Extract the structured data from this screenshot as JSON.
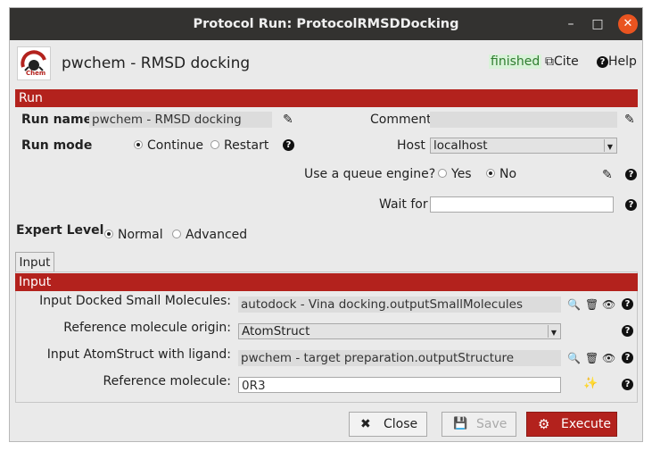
{
  "window": {
    "title": "Protocol Run: ProtocolRMSDDocking",
    "minimize": "–",
    "maximize": "□",
    "close": "✕"
  },
  "header": {
    "logo_text": "Chem",
    "title": "pwchem - RMSD docking",
    "status": "finished",
    "cite": "Cite",
    "help": "Help",
    "cite_icon": "external-link-icon",
    "help_icon": "question-circle-icon"
  },
  "run_section": {
    "title": "Run",
    "run_name_label": "Run name",
    "run_name_value": "pwchem - RMSD docking",
    "comment_label": "Comment",
    "comment_value": "",
    "run_mode_label": "Run mode",
    "run_mode_options": [
      "Continue",
      "Restart"
    ],
    "run_mode_selected": "Continue",
    "host_label": "Host",
    "host_value": "localhost",
    "queue_label": "Use a queue engine?",
    "queue_options": [
      "Yes",
      "No"
    ],
    "queue_selected": "No",
    "wait_for_label": "Wait for",
    "wait_for_value": ""
  },
  "expert_level": {
    "label": "Expert Level",
    "options": [
      "Normal",
      "Advanced"
    ],
    "selected": "Normal"
  },
  "tabs": [
    {
      "label": "Input"
    }
  ],
  "input_section": {
    "title": "Input",
    "docked_label": "Input Docked Small Molecules:",
    "docked_value": "autodock - Vina docking.outputSmallMolecules",
    "ref_origin_label": "Reference molecule origin:",
    "ref_origin_value": "AtomStruct",
    "atomstruct_label": "Input AtomStruct with ligand:",
    "atomstruct_value": "pwchem - target preparation.outputStructure",
    "ref_mol_label": "Reference molecule:",
    "ref_mol_value": "0R3"
  },
  "buttons": {
    "close": "Close",
    "save": "Save",
    "execute": "Execute"
  },
  "icons": {
    "q": "?",
    "pencil": "✎",
    "search": "🔍",
    "trash": "🗑",
    "eye": "👁",
    "wand": "✨",
    "close_x": "✖",
    "gears": "⚙",
    "save": "💾",
    "ext": "⧉"
  },
  "colors": {
    "accent": "#b3221d",
    "titlebar": "#333230",
    "status_bg": "#d9f2d9",
    "status_fg": "#2f7d2f",
    "window_close": "#e95420"
  }
}
